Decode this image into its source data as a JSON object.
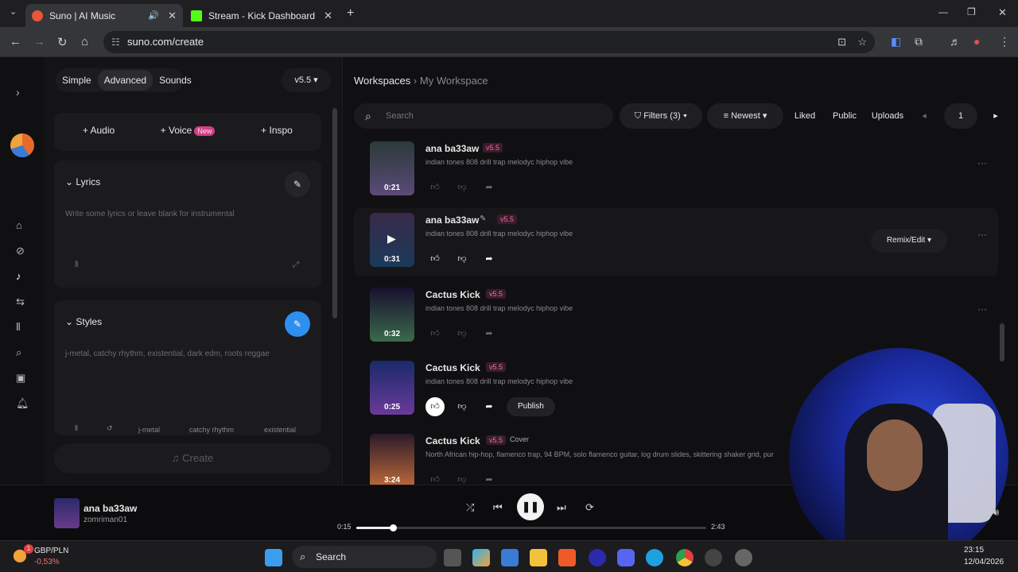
{
  "browser": {
    "tabs": [
      {
        "title": "Suno | AI Music",
        "active": true
      },
      {
        "title": "Stream - Kick Dashboard",
        "active": false
      }
    ],
    "new_tab": "+",
    "url": "suno.com/create"
  },
  "create_panel": {
    "modes": [
      "Simple",
      "Advanced",
      "Sounds"
    ],
    "active_mode": "Advanced",
    "version": "v5.5",
    "add_buttons": {
      "audio": "+ Audio",
      "voice": "+ Voice",
      "voice_badge": "New",
      "inspo": "+ Inspo"
    },
    "lyrics": {
      "title": "Lyrics",
      "placeholder": "Write some lyrics or leave blank for instrumental"
    },
    "styles": {
      "title": "Styles",
      "placeholder": "j-metal, catchy rhythm, existential, dark edm, roots reggae",
      "chips": [
        "j-metal",
        "catchy rhythm",
        "existential"
      ]
    },
    "create_label": "Create"
  },
  "workspace": {
    "breadcrumb_root": "Workspaces",
    "breadcrumb_current": "My Workspace",
    "search_placeholder": "Search",
    "filters_label": "Filters (3)",
    "sort_label": "Newest",
    "quick_filters": [
      "Liked",
      "Public",
      "Uploads"
    ],
    "page": "1",
    "songs": [
      {
        "title": "ana ba33aw",
        "version": "v5.5",
        "desc": "indian tones 808 drill trap melodyc hiphop vibe",
        "duration": "0:21"
      },
      {
        "title": "ana ba33aw",
        "version": "v5.5",
        "desc": "indian tones 808 drill trap melodyc hiphop vibe",
        "duration": "0:31",
        "remix": "Remix/Edit"
      },
      {
        "title": "Cactus Kick",
        "version": "v5.5",
        "desc": "indian tones 808 drill trap melodyc hiphop vibe",
        "duration": "0:32"
      },
      {
        "title": "Cactus Kick",
        "version": "v5.5",
        "desc": "indian tones 808 drill trap melodyc hiphop vibe",
        "duration": "0:25",
        "publish": "Publish"
      },
      {
        "title": "Cactus Kick",
        "version": "v5.5",
        "tag": "Cover",
        "desc": "North African hip-hop, flamenco trap, 94 BPM, solo flamenco guitar, log drum slides, skittering shaker grid, pur",
        "duration": "3:24"
      }
    ]
  },
  "player": {
    "title": "ana ba33aw",
    "user": "zomriman01",
    "elapsed": "0:15",
    "total": "2:43",
    "progress": 0.105
  },
  "taskbar": {
    "fx_pair": "GBP/PLN",
    "fx_change": "-0,53%",
    "fx_badge": "1",
    "search": "Search",
    "time": "23:15",
    "date": "12/04/2026"
  },
  "colors": {
    "accent_pink": "#d43f86",
    "accent_blue": "#2d8ff0"
  }
}
